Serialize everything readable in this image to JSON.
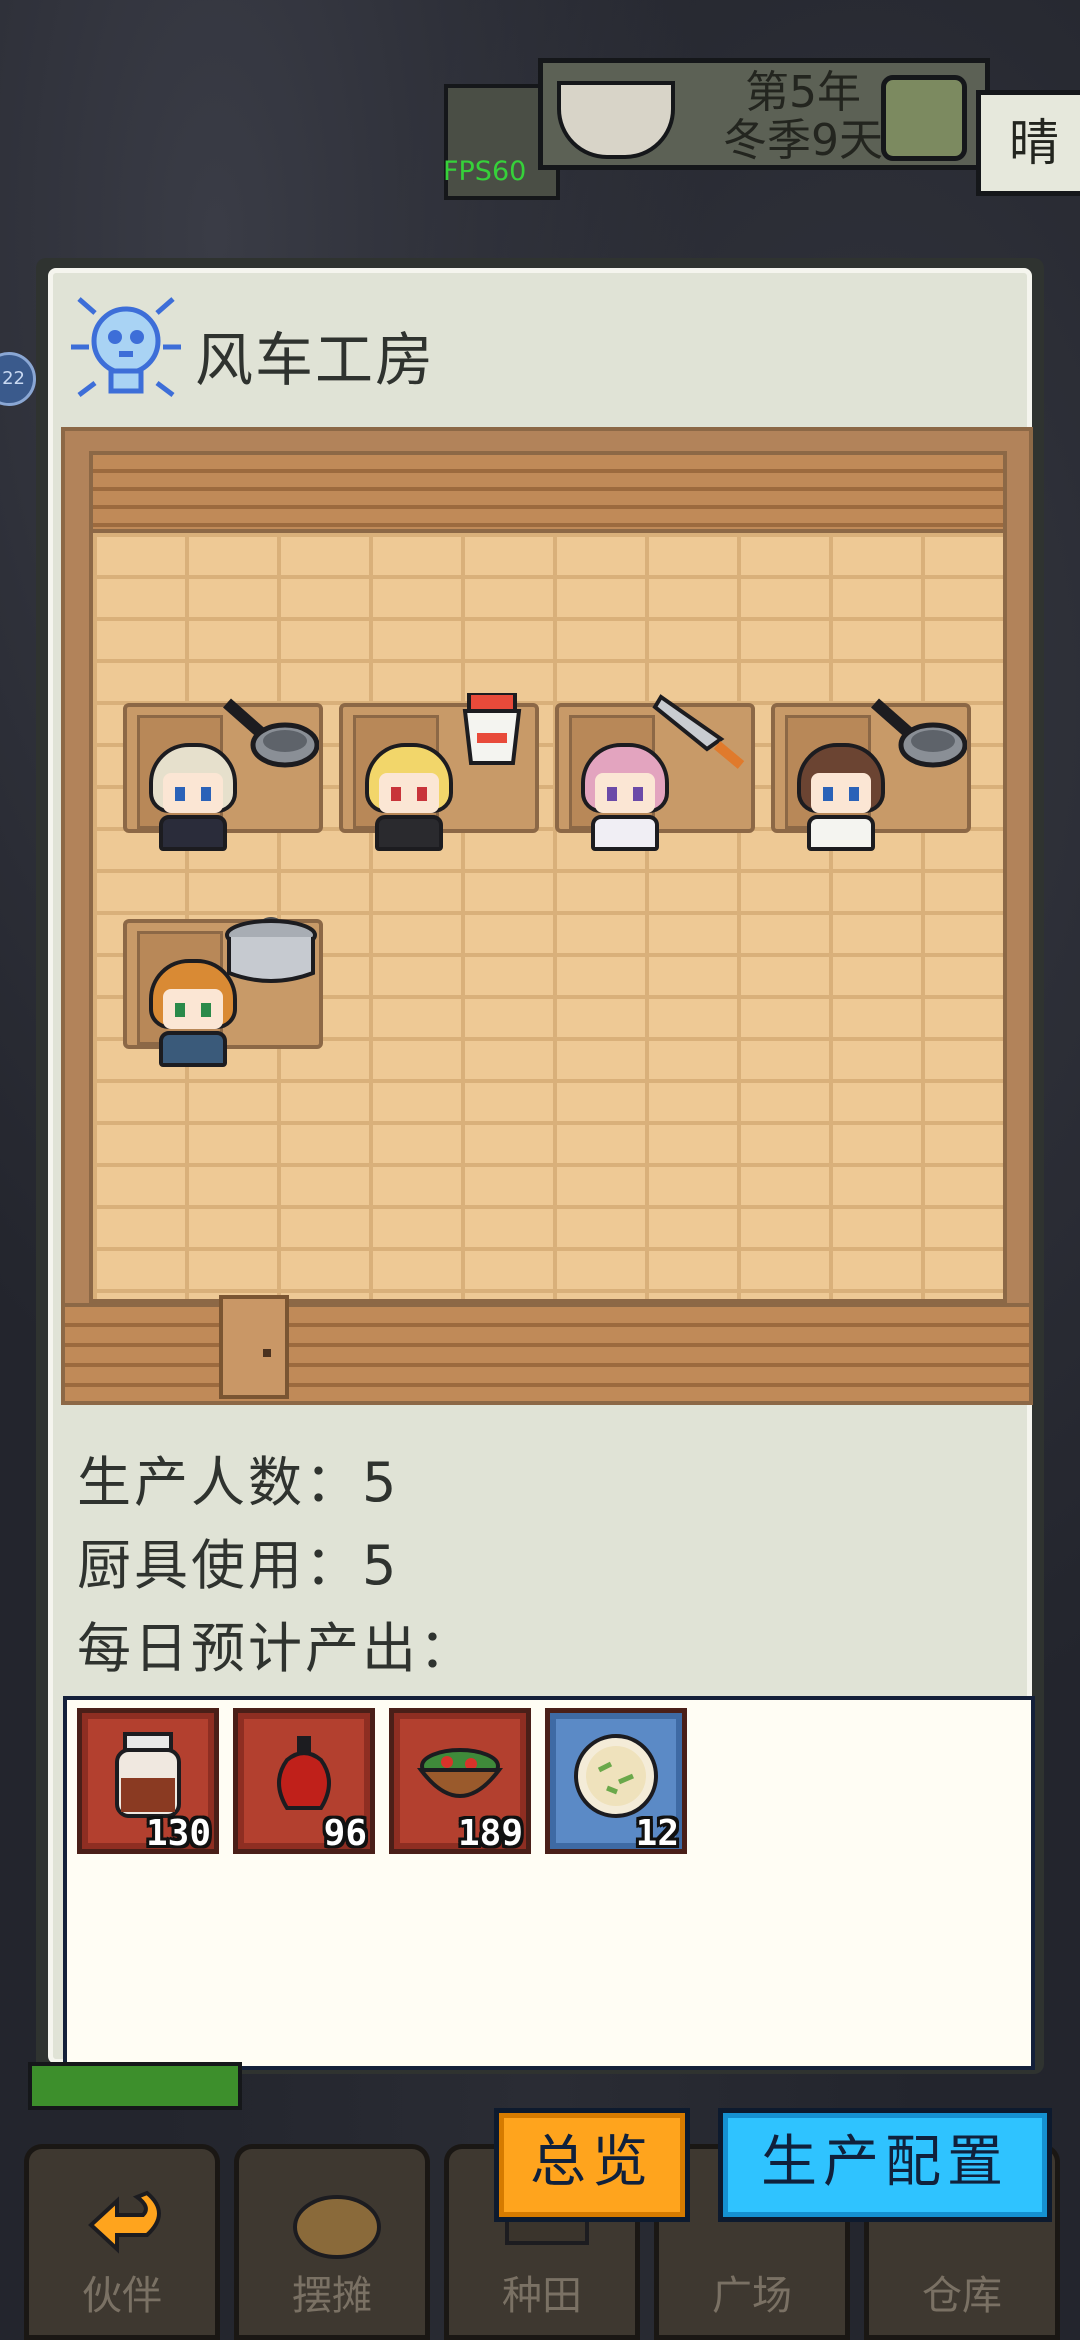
{
  "hud": {
    "fps": "FPS60",
    "date_line1": "第5年",
    "date_line2": "冬季9天",
    "weather": "晴",
    "side_badge": "22"
  },
  "dialog": {
    "title": "风车工房",
    "stats": {
      "workers": "生产人数：5",
      "tools": "厨具使用：5",
      "daily_output_label": "每日预计产出："
    },
    "outputs": [
      {
        "icon": "jar-icon",
        "quantity": "130",
        "rarity_color": "#b3402f"
      },
      {
        "icon": "sauce-bottle-icon",
        "quantity": "96",
        "rarity_color": "#b3402f"
      },
      {
        "icon": "salad-bowl-icon",
        "quantity": "189",
        "rarity_color": "#b3402f"
      },
      {
        "icon": "rice-porridge-icon",
        "quantity": "12",
        "rarity_color": "#5b8ac6"
      }
    ]
  },
  "buttons": {
    "overview": "总览",
    "production_config": "生产配置"
  },
  "nav": {
    "tabs": [
      {
        "label": "伙伴",
        "icon": "return-arrow-icon"
      },
      {
        "label": "摆摊",
        "icon": "basket-icon"
      },
      {
        "label": "种田",
        "icon": "field-icon"
      },
      {
        "label": "广场",
        "icon": "plaza-icon"
      },
      {
        "label": "仓库",
        "icon": "warehouse-icon"
      }
    ]
  },
  "colors": {
    "accent_orange": "#ffa41d",
    "accent_blue": "#2fc3ff",
    "panel_bg": "#e0e3d6",
    "fps_green": "#36d13a"
  }
}
